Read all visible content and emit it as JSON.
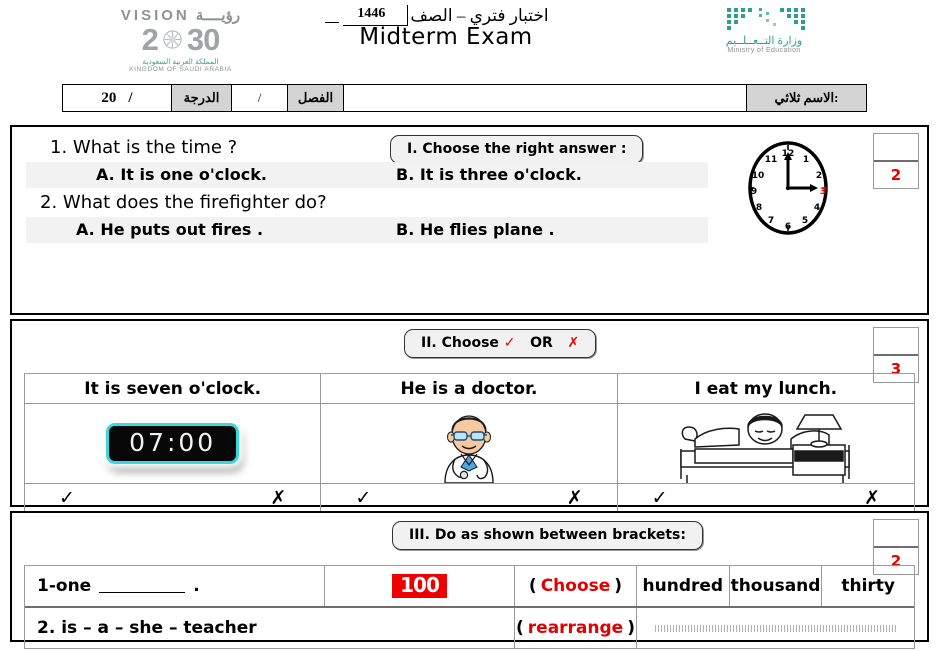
{
  "header": {
    "vision_logo": {
      "word_en": "VISION",
      "word_ar": "رؤيــــة",
      "year_left": "2",
      "year_right": "30",
      "sub_ar": "المملكة العربية السعودية",
      "sub_en": "KINGDOM OF SAUDI ARABIA"
    },
    "title_ar": "اختبار فتري – الصف",
    "year": "1446",
    "title_en": "Midterm Exam",
    "moe_logo": {
      "name_ar": "وزارة التــعــلــيم",
      "name_en": "Ministry of Education"
    }
  },
  "info_table": {
    "grade_value": "20",
    "grade_slash": "/",
    "grade_label": "الدرجة",
    "class_value": "/",
    "class_label": "الفصل",
    "name_value": "",
    "name_label": "الاسم ثلاثي:"
  },
  "sections": [
    {
      "banner": "I. Choose the right answer :",
      "score_top": "",
      "score_bottom": "2",
      "questions": [
        {
          "prompt": "1.  What is the time  ?",
          "option_a": "A. It is one o'clock.",
          "option_b": "B. It is three o'clock."
        },
        {
          "prompt": "2. What does the firefighter do?",
          "option_a": "A. He puts out fires .",
          "option_b": "B. He flies plane ."
        }
      ],
      "clock_icon": "analog-clock-icon",
      "clock_highlight_hour": "3"
    },
    {
      "banner_prefix": "II. Choose",
      "banner_check": "✓",
      "banner_or": "OR",
      "banner_cross": "✗",
      "score_top": "",
      "score_bottom": "3",
      "columns": [
        {
          "statement": "It is seven o'clock.",
          "image": "digital-clock-07-00",
          "image_text": "07:00",
          "mark_true": "✓",
          "mark_false": "✗"
        },
        {
          "statement": "He is a doctor.",
          "image": "doctor-illustration",
          "image_text": "",
          "mark_true": "✓",
          "mark_false": "✗"
        },
        {
          "statement": "I eat my lunch.",
          "image": "child-waking-in-bed-illustration",
          "image_text": "",
          "mark_true": "✓",
          "mark_false": "✗"
        }
      ]
    },
    {
      "banner": "III. Do as shown between brackets:",
      "score_top": "",
      "score_bottom": "2",
      "rows": [
        {
          "prompt_prefix": "1-one",
          "prompt_suffix": ".",
          "badge": "100",
          "bracket_open": "(",
          "instruction": "Choose",
          "bracket_close": ")",
          "choices": [
            "hundred",
            "thousand",
            "thirty"
          ]
        },
        {
          "prompt_prefix": "2.  is – a – she – teacher",
          "prompt_suffix": "",
          "badge": "",
          "bracket_open": "(",
          "instruction": "rearrange",
          "bracket_close": ")",
          "choices": []
        }
      ]
    }
  ],
  "colors": {
    "red": "#e30000",
    "teal": "#2e9e8f",
    "cyan": "#39d8e0",
    "shade": "#d4d4d4"
  }
}
